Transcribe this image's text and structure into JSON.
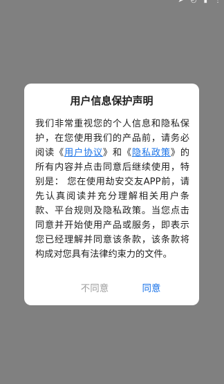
{
  "status_bar": {
    "icons": [
      "location-icon",
      "clock-icon",
      "battery-icon",
      "more-icon"
    ]
  },
  "dialog": {
    "title": "用户信息保护声明",
    "body": {
      "part1": "我们非常重视您的个人信息和隐私保护，在您使用我们的产品前，请务必阅读《",
      "link_user_agreement": "用户协议",
      "part2": "》和《",
      "link_privacy_policy": "隐私政策",
      "part3": "》的所有内容并点击同意后继续使用，特别是：  您在使用劫安交友APP前，请先认真阅读并充分理解相关用户条款、平台规则及隐私政策。当您点击同意并开始使用产品或服务，即表示您已经理解并同意该条款，该条款将构成对您具有法律约束力的文件。"
    },
    "buttons": {
      "disagree": "不同意",
      "agree": "同意"
    }
  },
  "colors": {
    "overlay": "#808080",
    "dialog_bg": "#ffffff",
    "link": "#1a73e8",
    "disabled_text": "#9e9e9e"
  }
}
